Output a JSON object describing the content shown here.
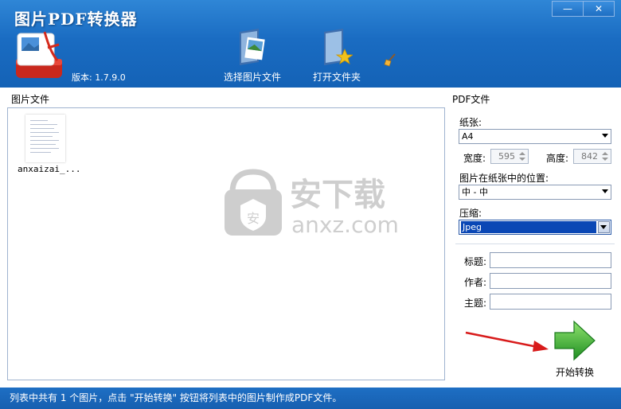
{
  "header": {
    "app_title": "图片PDF转换器",
    "version": "版本: 1.7.9.0",
    "select_images_label": "选择图片文件",
    "open_folder_label": "打开文件夹"
  },
  "window": {
    "minimize_label": "—",
    "close_label": "✕"
  },
  "left": {
    "caption": "图片文件",
    "files": [
      {
        "name": "anxaizai_..."
      }
    ]
  },
  "right": {
    "caption": "PDF文件",
    "paper_label": "纸张:",
    "paper_value": "A4",
    "width_label": "宽度:",
    "width_value": "595",
    "height_label": "高度:",
    "height_value": "842",
    "position_label": "图片在纸张中的位置:",
    "position_value": "中 - 中",
    "compress_label": "压缩:",
    "compress_value": "Jpeg",
    "title_label": "标题:",
    "author_label": "作者:",
    "subject_label": "主题:",
    "start_label": "开始转换"
  },
  "watermark": {
    "cn": "安下载",
    "en": "anxz.com"
  },
  "status": {
    "text": "列表中共有 1 个图片，点击 \"开始转换\" 按钮将列表中的图片制作成PDF文件。"
  },
  "colors": {
    "header_blue": "#1a6cc2",
    "status_blue": "#1e6fc4",
    "start_green": "#3aa52d"
  }
}
